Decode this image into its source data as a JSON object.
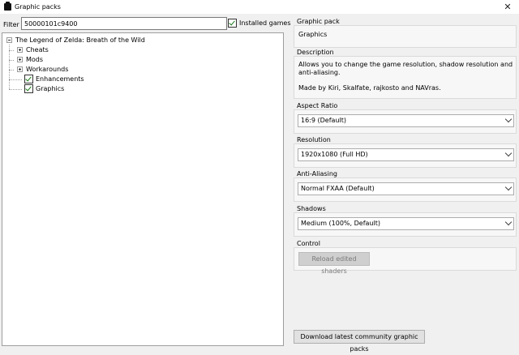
{
  "window": {
    "title": "Graphic packs",
    "close_glyph": "✕"
  },
  "filter": {
    "label": "Filter",
    "value": "50000101c9400"
  },
  "installed_games": {
    "label": "Installed games",
    "checked": true
  },
  "tree": {
    "root": "The Legend of Zelda: Breath of the Wild",
    "children": [
      "Cheats",
      "Mods",
      "Workarounds",
      "Enhancements",
      "Graphics"
    ]
  },
  "details": {
    "graphic_pack": {
      "title": "Graphic pack",
      "value": "Graphics"
    },
    "description": {
      "title": "Description",
      "line1": "Allows you to change the game resolution, shadow resolution and",
      "line2": "anti-aliasing.",
      "line3": "Made by Kiri, Skalfate, rajkosto and NAVras."
    },
    "aspect_ratio": {
      "title": "Aspect Ratio",
      "value": "16:9 (Default)"
    },
    "resolution": {
      "title": "Resolution",
      "value": "1920x1080 (Full HD)"
    },
    "anti_aliasing": {
      "title": "Anti-Aliasing",
      "value": "Normal FXAA (Default)"
    },
    "shadows": {
      "title": "Shadows",
      "value": "Medium (100%, Default)"
    },
    "control": {
      "title": "Control",
      "reload_label": "Reload edited shaders"
    }
  },
  "download_button": "Download latest community graphic packs",
  "icons": {
    "app": "app-icon",
    "close": "close-icon",
    "expander": "plus-icon",
    "check": "checkmark-icon"
  }
}
